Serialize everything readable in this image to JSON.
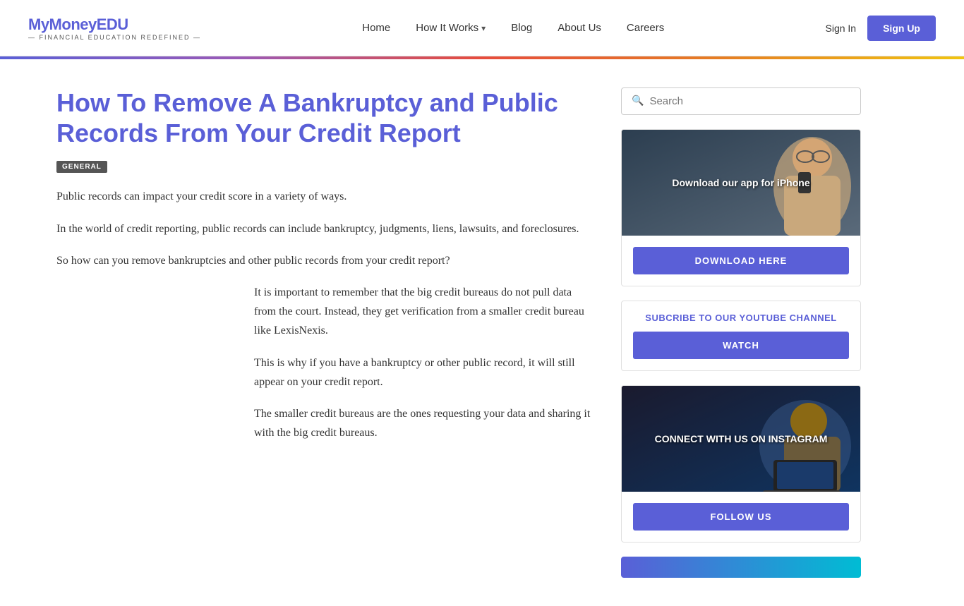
{
  "site": {
    "logo_main_prefix": "MyMoney",
    "logo_main_suffix": "EDU",
    "logo_sub": "— Financial Education Redefined —"
  },
  "nav": {
    "home": "Home",
    "how_it_works": "How It Works",
    "blog": "Blog",
    "about_us": "About Us",
    "careers": "Careers",
    "sign_in": "Sign In",
    "sign_up": "Sign Up"
  },
  "article": {
    "title": "How To Remove A Bankruptcy and Public Records From Your Credit Report",
    "tag": "GENERAL",
    "para1": "Public records can impact your credit score in a variety of ways.",
    "para2": "In the world of credit reporting, public records can include bankruptcy, judgments, liens, lawsuits, and foreclosures.",
    "para3": "So how can you remove bankruptcies and other public records from your credit report?",
    "quote1": "It is important to remember that the big credit bureaus do not pull data from the court. Instead, they get verification from a smaller credit bureau like LexisNexis.",
    "quote2": "This is why if you have a bankruptcy or other public record, it will still appear on your credit report.",
    "quote3": "The smaller credit bureaus are the ones requesting your data and sharing it with the big credit bureaus."
  },
  "sidebar": {
    "search_placeholder": "Search",
    "iphone_card": {
      "title": "Download our app for iPhone",
      "btn": "DOWNLOAD HERE"
    },
    "youtube_card": {
      "title": "SUBCRIBE TO OUR YOUTUBE CHANNEL",
      "btn": "WATCH"
    },
    "instagram_card": {
      "title": "CONNECT WITH US ON INSTAGRAM",
      "btn": "FOLLOW US"
    }
  }
}
